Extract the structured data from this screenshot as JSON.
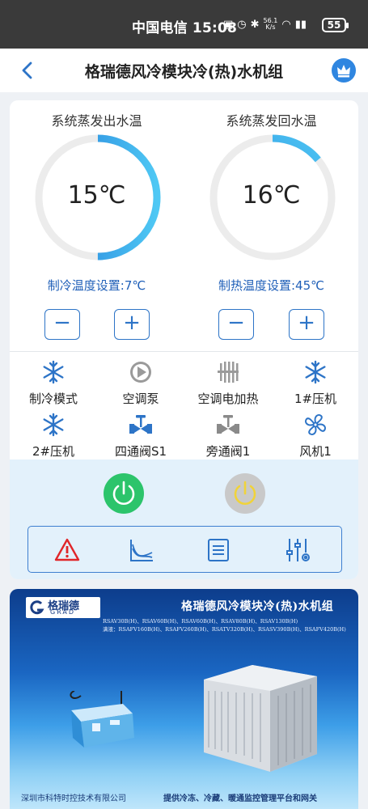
{
  "status_bar": {
    "carrier_time": "中国电信 15:08",
    "net_speed_top": "56.1",
    "net_speed_unit": "K/s",
    "battery": "55"
  },
  "header": {
    "title": "格瑞德风冷模块冷(热)水机组"
  },
  "gauges": [
    {
      "title": "系统蒸发出水温",
      "value": "15℃",
      "setting": "制冷温度设置:7℃",
      "fill": 0.5
    },
    {
      "title": "系统蒸发回水温",
      "value": "16℃",
      "setting": "制热温度设置:45℃",
      "fill": 0.14
    }
  ],
  "buttons": {
    "minus": "−",
    "plus": "+"
  },
  "devices": [
    {
      "label": "制冷模式",
      "icon": "snowflake-icon",
      "color": "#2d74c7"
    },
    {
      "label": "空调泵",
      "icon": "pump-icon",
      "color": "#9a9a9a"
    },
    {
      "label": "空调电加热",
      "icon": "heater-icon",
      "color": "#9a9a9a"
    },
    {
      "label": "1#压机",
      "icon": "snowflake-icon",
      "color": "#2d74c7"
    },
    {
      "label": "2#压机",
      "icon": "snowflake-icon",
      "color": "#2d74c7"
    },
    {
      "label": "四通阀S1",
      "icon": "valve-icon",
      "color": "#2d74c7"
    },
    {
      "label": "旁通阀1",
      "icon": "valve-icon",
      "color": "#8a8a8a"
    },
    {
      "label": "风机1",
      "icon": "fan-icon",
      "color": "#2d74c7"
    }
  ],
  "power": {
    "on_color": "#2cc46b",
    "off_color": "#c9c9c9"
  },
  "toolbar": [
    "alarm-icon",
    "chart-icon",
    "list-icon",
    "settings-sliders-icon"
  ],
  "banner": {
    "logo_text": "格瑞德",
    "logo_sub": "GRAD",
    "title": "格瑞德风冷模块冷(热)水机组",
    "models": [
      "RSAV30B(H)、RSAV60B(H)、RSAV60B(H)、RSAV80B(H)、RSAV130B(H)",
      "满液：RSAFV160B(H)、RSAFV260B(H)、RSATV320B(H)、RSASV390B(H)、RSAFV420B(H)"
    ],
    "footer_left": "深圳市科特时控技术有限公司",
    "footer_right": "提供冷冻、冷藏、暖通监控管理平台和网关"
  }
}
